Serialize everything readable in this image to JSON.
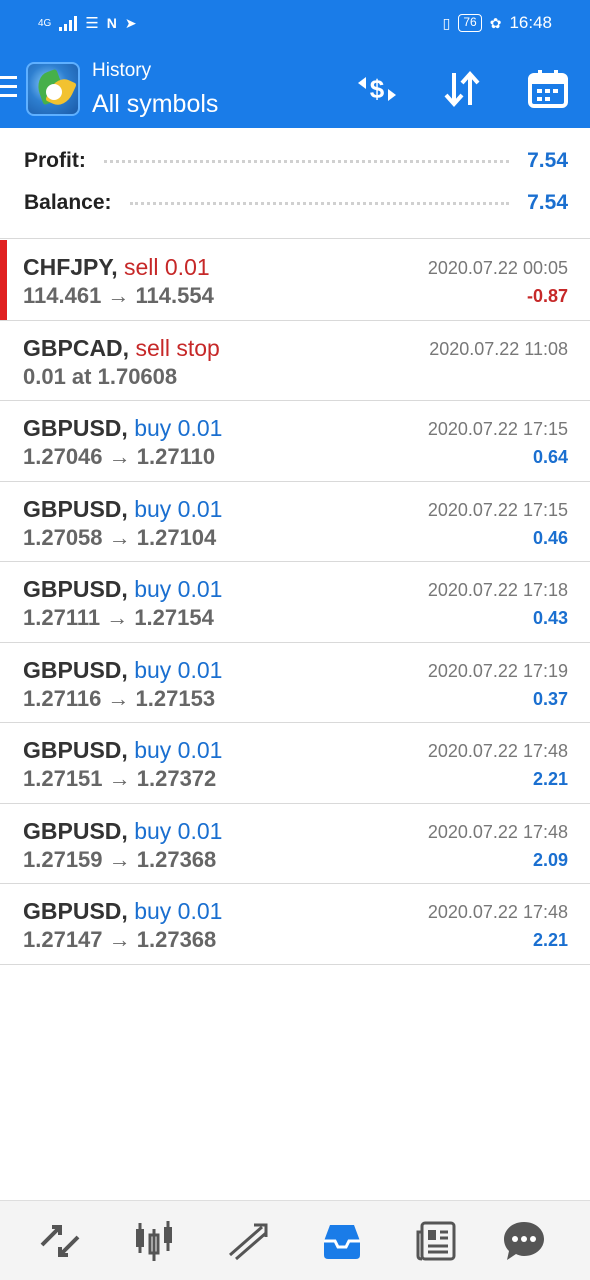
{
  "status_bar": {
    "network": "4G",
    "battery": "76",
    "time": "16:48"
  },
  "app_bar": {
    "title": "History",
    "subtitle": "All symbols"
  },
  "summary": {
    "profit_label": "Profit:",
    "profit_value": "7.54",
    "balance_label": "Balance:",
    "balance_value": "7.54"
  },
  "trades": [
    {
      "symbol": "CHFJPY,",
      "type": "sell 0.01",
      "prices": "114.461 → 114.554",
      "date": "2020.07.22 00:05",
      "profit": "-0.87"
    },
    {
      "symbol": "GBPCAD,",
      "type": "sell stop",
      "prices": "0.01 at 1.70608",
      "date": "2020.07.22 11:08",
      "profit": ""
    },
    {
      "symbol": "GBPUSD,",
      "type": "buy 0.01",
      "prices": "1.27046 → 1.27110",
      "date": "2020.07.22 17:15",
      "profit": "0.64"
    },
    {
      "symbol": "GBPUSD,",
      "type": "buy 0.01",
      "prices": "1.27058 → 1.27104",
      "date": "2020.07.22 17:15",
      "profit": "0.46"
    },
    {
      "symbol": "GBPUSD,",
      "type": "buy 0.01",
      "prices": "1.27111 → 1.27154",
      "date": "2020.07.22 17:18",
      "profit": "0.43"
    },
    {
      "symbol": "GBPUSD,",
      "type": "buy 0.01",
      "prices": "1.27116 → 1.27153",
      "date": "2020.07.22 17:19",
      "profit": "0.37"
    },
    {
      "symbol": "GBPUSD,",
      "type": "buy 0.01",
      "prices": "1.27151 → 1.27372",
      "date": "2020.07.22 17:48",
      "profit": "2.21"
    },
    {
      "symbol": "GBPUSD,",
      "type": "buy 0.01",
      "prices": "1.27159 → 1.27368",
      "date": "2020.07.22 17:48",
      "profit": "2.09"
    },
    {
      "symbol": "GBPUSD,",
      "type": "buy 0.01",
      "prices": "1.27147 → 1.27368",
      "date": "2020.07.22 17:48",
      "profit": "2.21"
    }
  ],
  "bottom_nav": {
    "items": [
      {
        "icon": "quotes-icon"
      },
      {
        "icon": "chart-icon"
      },
      {
        "icon": "trade-icon"
      },
      {
        "icon": "history-icon",
        "active": true
      },
      {
        "icon": "news-icon"
      },
      {
        "icon": "chat-icon"
      }
    ]
  },
  "colors": {
    "accent": "#1a7ce8",
    "sell": "#c62828",
    "buy": "#1a6fd0",
    "active_nav": "#1a7ce8",
    "inactive_nav": "#555555"
  }
}
